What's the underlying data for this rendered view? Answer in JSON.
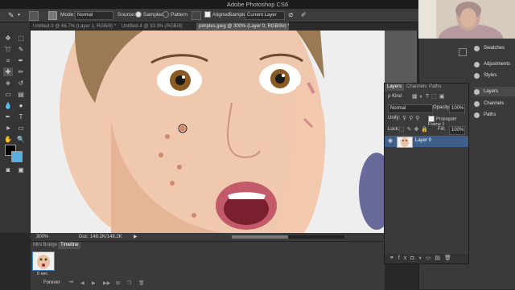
{
  "window": {
    "title": "Adobe Photoshop CS6"
  },
  "options_bar": {
    "mode_label": "Mode:",
    "mode_value": "Normal",
    "source_label": "Source:",
    "source_sampled": "Sampled",
    "source_pattern": "Pattern",
    "aligned_label": "Aligned",
    "sample_label": "Sample:",
    "sample_value": "Current Layer"
  },
  "doc_tabs": [
    {
      "label": "Untitled-3 @ 66.7% (Layer 1, RGB/8) *"
    },
    {
      "label": "Untitled-4 @ 33.3% (RGB/8)"
    },
    {
      "label": "pimples.jpeg @ 300% (Layer 0, RGB/8#) *"
    }
  ],
  "status": {
    "zoom": "300%",
    "doc": "Doc: 148.2K/148.2K"
  },
  "bottom_panel": {
    "tabs": [
      "Mini Bridge",
      "Timeline"
    ],
    "frame_time": "0 sec.",
    "loop": "Forever"
  },
  "right_dock": [
    "Swatches",
    "Adjustments",
    "Styles",
    "Layers",
    "Channels",
    "Paths"
  ],
  "layers_panel": {
    "tabs": [
      "Layers",
      "Channels",
      "Paths"
    ],
    "kind_label": "Kind",
    "blend_mode": "Normal",
    "opacity_label": "Opacity:",
    "opacity_value": "100%",
    "unify_label": "Unify:",
    "propagate_label": "Propagate Frame 1",
    "lock_label": "Lock:",
    "fill_label": "Fill:",
    "fill_value": "100%",
    "layer_name": "Layer 0"
  },
  "colors": {
    "foreground": "#000000",
    "background": "#5aaee0"
  }
}
